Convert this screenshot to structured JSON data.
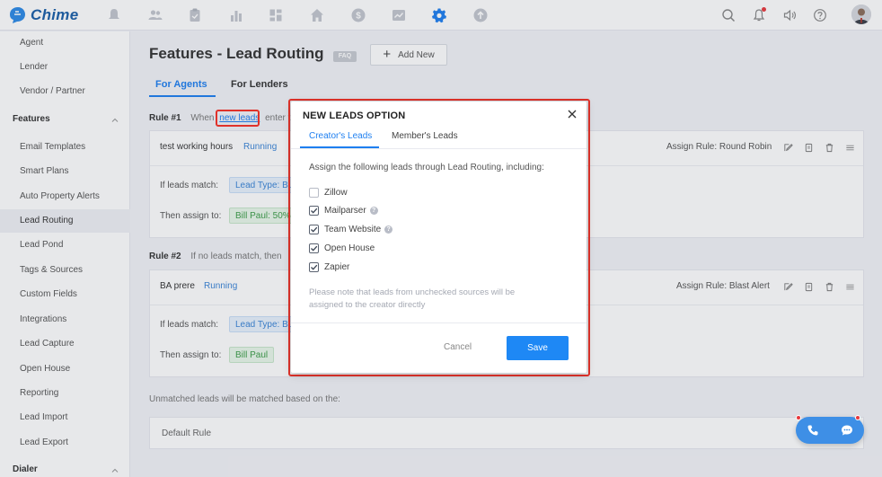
{
  "app": {
    "name": "Chime"
  },
  "sidebar": {
    "items_top": [
      "Agent",
      "Lender",
      "Vendor / Partner"
    ],
    "section_features": "Features",
    "feature_items": [
      "Email Templates",
      "Smart Plans",
      "Auto Property Alerts",
      "Lead Routing",
      "Lead Pond",
      "Tags & Sources",
      "Custom Fields",
      "Integrations",
      "Lead Capture",
      "Open House",
      "Reporting",
      "Lead Import",
      "Lead Export"
    ],
    "active_item": "Lead Routing",
    "section_dialer": "Dialer"
  },
  "page": {
    "title": "Features - Lead Routing",
    "faq": "FAQ",
    "add_new": "Add New",
    "tabs": [
      "For Agents",
      "For Lenders"
    ]
  },
  "rule1": {
    "label": "Rule #1",
    "prefix": "When",
    "link": "new leads",
    "suffix": "enter t",
    "name": "test working hours",
    "status": "Running",
    "assign_rule": "Assign Rule: Round Robin",
    "if_label": "If leads match:",
    "if_tag": "Lead Type: Bu",
    "then_label": "Then assign to:",
    "then_tag": "Bill Paul: 50%"
  },
  "rule2": {
    "label": "Rule #2",
    "desc": "If no leads match, then",
    "name": "BA prere",
    "status": "Running",
    "assign_rule": "Assign Rule: Blast Alert",
    "if_label": "If leads match:",
    "if_tag": "Lead Type: Bu",
    "then_label": "Then assign to:",
    "then_tag": "Bill Paul"
  },
  "unmatched": {
    "label": "Unmatched leads will be matched based on the:",
    "default_rule": "Default Rule"
  },
  "modal": {
    "title": "NEW LEADS OPTION",
    "tabs": [
      "Creator's Leads",
      "Member's Leads"
    ],
    "intro": "Assign the following leads through Lead Routing, including:",
    "options": [
      {
        "label": "Zillow",
        "checked": false,
        "help": false
      },
      {
        "label": "Mailparser",
        "checked": true,
        "help": true
      },
      {
        "label": "Team Website",
        "checked": true,
        "help": true
      },
      {
        "label": "Open House",
        "checked": true,
        "help": false
      },
      {
        "label": "Zapier",
        "checked": true,
        "help": false
      }
    ],
    "note": "Please note that leads from unchecked sources will be assigned to the creator directly",
    "cancel": "Cancel",
    "save": "Save"
  },
  "colors": {
    "accent": "#1e88f5",
    "brand": "#1b5fa8",
    "highlight": "#e0322a"
  }
}
